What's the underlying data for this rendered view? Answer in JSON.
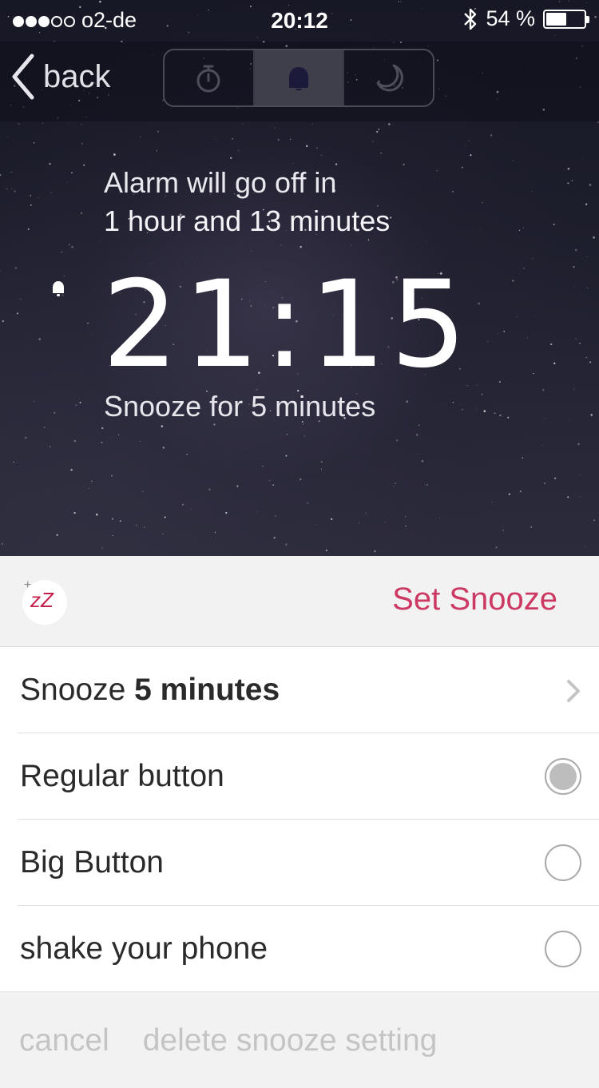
{
  "status_bar": {
    "carrier": "o2-de",
    "signal_bars_full": 3,
    "signal_bars_total": 5,
    "time": "20:12",
    "bluetooth_icon": "bluetooth-icon",
    "battery_percent_label": "54 %",
    "battery_level": 0.54
  },
  "nav": {
    "back_label": "back",
    "segments": [
      {
        "icon": "stopwatch-icon",
        "active": false
      },
      {
        "icon": "bell-icon",
        "active": true
      },
      {
        "icon": "moon-icon",
        "active": false
      }
    ]
  },
  "alarm": {
    "countdown_prefix": "Alarm will go off in",
    "countdown_value": "1 hour and 13 minutes",
    "time": "21:15",
    "snooze_summary": "Snooze for 5 minutes"
  },
  "snooze_panel": {
    "icon_text": "zZ",
    "icon_plus": "+",
    "title": "Set Snooze",
    "accent_color": "#cc3a63"
  },
  "options": {
    "duration_prefix": "Snooze",
    "duration_value": "5 minutes",
    "methods": [
      {
        "label": "Regular button",
        "selected": true
      },
      {
        "label": "Big Button",
        "selected": false
      },
      {
        "label": "shake your phone",
        "selected": false
      }
    ]
  },
  "footer": {
    "cancel_label": "cancel",
    "delete_label": "delete snooze setting"
  }
}
